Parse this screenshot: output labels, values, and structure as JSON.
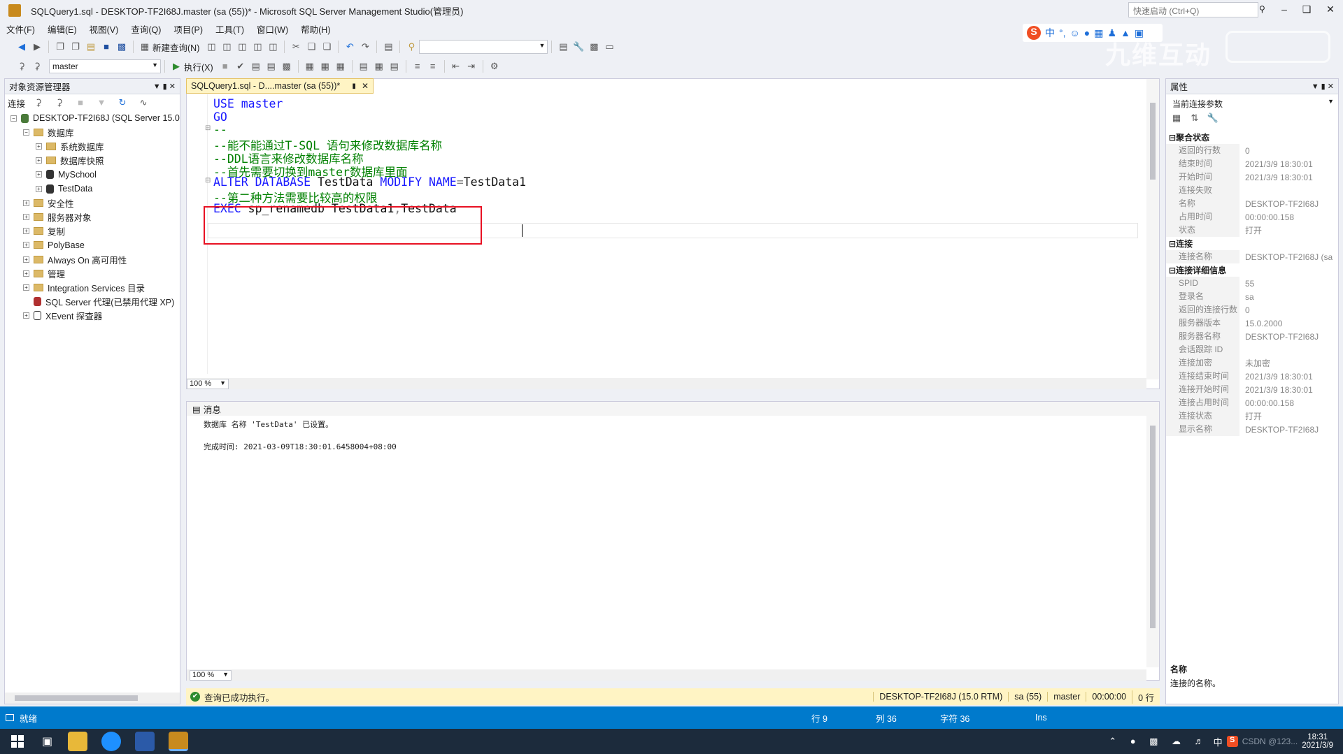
{
  "titlebar": {
    "title": "SQLQuery1.sql - DESKTOP-TF2I68J.master (sa (55))* - Microsoft SQL Server Management Studio(管理员)",
    "quick_launch": "快速启动 (Ctrl+Q)"
  },
  "menu": [
    "文件(F)",
    "编辑(E)",
    "视图(V)",
    "查询(Q)",
    "项目(P)",
    "工具(T)",
    "窗口(W)",
    "帮助(H)"
  ],
  "toolbar": {
    "new_query": "新建查询(N)",
    "database": "master",
    "execute": "执行(X)"
  },
  "watermark": {
    "brand": "九维互动"
  },
  "object_explorer": {
    "title": "对象资源管理器",
    "connect": "连接",
    "tree": [
      {
        "label": "DESKTOP-TF2I68J (SQL Server 15.0",
        "level": 0,
        "exp": "−",
        "icon": "server"
      },
      {
        "label": "数据库",
        "level": 1,
        "exp": "−",
        "icon": "folder"
      },
      {
        "label": "系统数据库",
        "level": 2,
        "exp": "+",
        "icon": "folder"
      },
      {
        "label": "数据库快照",
        "level": 2,
        "exp": "+",
        "icon": "folder"
      },
      {
        "label": "MySchool",
        "level": 2,
        "exp": "+",
        "icon": "db"
      },
      {
        "label": "TestData",
        "level": 2,
        "exp": "+",
        "icon": "db"
      },
      {
        "label": "安全性",
        "level": 1,
        "exp": "+",
        "icon": "folder"
      },
      {
        "label": "服务器对象",
        "level": 1,
        "exp": "+",
        "icon": "folder"
      },
      {
        "label": "复制",
        "level": 1,
        "exp": "+",
        "icon": "folder"
      },
      {
        "label": "PolyBase",
        "level": 1,
        "exp": "+",
        "icon": "folder"
      },
      {
        "label": "Always On 高可用性",
        "level": 1,
        "exp": "+",
        "icon": "folder"
      },
      {
        "label": "管理",
        "level": 1,
        "exp": "+",
        "icon": "folder"
      },
      {
        "label": "Integration Services 目录",
        "level": 1,
        "exp": "+",
        "icon": "folder"
      },
      {
        "label": "SQL Server 代理(已禁用代理 XP)",
        "level": 1,
        "exp": "",
        "icon": "agent"
      },
      {
        "label": "XEvent 探查器",
        "level": 1,
        "exp": "+",
        "icon": "xevent"
      }
    ]
  },
  "editor": {
    "tab": "SQLQuery1.sql - D....master (sa (55))*",
    "lines": [
      [
        {
          "t": "USE",
          "c": "kw"
        },
        {
          "t": " master",
          "c": "kw"
        }
      ],
      [
        {
          "t": "GO",
          "c": "kw"
        }
      ],
      [
        {
          "t": "--",
          "c": "cm"
        }
      ],
      [
        {
          "t": "--能不能通过T-SQL 语句来修改数据库名称",
          "c": "cm"
        }
      ],
      [
        {
          "t": "--DDL语言来修改数据库名称",
          "c": "cm"
        }
      ],
      [
        {
          "t": "--首先需要切换到master数据库里面",
          "c": "cm"
        }
      ],
      [
        {
          "t": "ALTER DATABASE",
          "c": "kw"
        },
        {
          "t": " TestData ",
          "c": "id"
        },
        {
          "t": "MODIFY NAME",
          "c": "kw"
        },
        {
          "t": "=",
          "c": "gy"
        },
        {
          "t": "TestData1",
          "c": "id"
        }
      ],
      [
        {
          "t": "--第二种方法需要比较高的权限",
          "c": "cm"
        }
      ],
      [
        {
          "t": "EXEC",
          "c": "kw"
        },
        {
          "t": " sp_renamedb",
          "c": "id"
        },
        {
          "t": " TestData1",
          "c": "id"
        },
        {
          "t": ",",
          "c": "gy"
        },
        {
          "t": "TestData",
          "c": "id"
        }
      ]
    ],
    "zoom": "100 %"
  },
  "results": {
    "tab": "消息",
    "line1": "数据库 名称 'TestData' 已设置。",
    "line2": "完成时间: 2021-03-09T18:30:01.6458004+08:00",
    "zoom": "100 %"
  },
  "query_status": {
    "message": "查询已成功执行。",
    "server": "DESKTOP-TF2I68J (15.0 RTM)",
    "user": "sa (55)",
    "db": "master",
    "time": "00:00:00",
    "rows": "0 行"
  },
  "properties": {
    "title": "属性",
    "selector": "当前连接参数",
    "sections": [
      {
        "name": "聚合状态",
        "rows": [
          [
            "返回的行数",
            "0"
          ],
          [
            "结束时间",
            "2021/3/9 18:30:01"
          ],
          [
            "开始时间",
            "2021/3/9 18:30:01"
          ],
          [
            "连接失败",
            ""
          ],
          [
            "名称",
            "DESKTOP-TF2I68J"
          ],
          [
            "占用时间",
            "00:00:00.158"
          ],
          [
            "状态",
            "打开"
          ]
        ]
      },
      {
        "name": "连接",
        "rows": [
          [
            "连接名称",
            "DESKTOP-TF2I68J (sa"
          ]
        ]
      },
      {
        "name": "连接详细信息",
        "rows": [
          [
            "SPID",
            "55"
          ],
          [
            "登录名",
            "sa"
          ],
          [
            "返回的连接行数",
            "0"
          ],
          [
            "服务器版本",
            "15.0.2000"
          ],
          [
            "服务器名称",
            "DESKTOP-TF2I68J"
          ],
          [
            "会话跟踪 ID",
            ""
          ],
          [
            "连接加密",
            "未加密"
          ],
          [
            "连接结束时间",
            "2021/3/9 18:30:01"
          ],
          [
            "连接开始时间",
            "2021/3/9 18:30:01"
          ],
          [
            "连接占用时间",
            "00:00:00.158"
          ],
          [
            "连接状态",
            "打开"
          ],
          [
            "显示名称",
            "DESKTOP-TF2I68J"
          ]
        ]
      }
    ],
    "desc_title": "名称",
    "desc": "连接的名称。"
  },
  "statusbar": {
    "ready": "就绪",
    "line": "行 9",
    "col": "列 36",
    "char": "字符 36",
    "ins": "Ins"
  },
  "taskbar": {
    "time": "18:31",
    "date": "2021/3/9",
    "ime": "中",
    "csdn": "CSDN @123..."
  },
  "colors": {
    "accent": "#007acc",
    "highlight_box": "#e81123",
    "tab_yellow": "#fff4c4"
  }
}
